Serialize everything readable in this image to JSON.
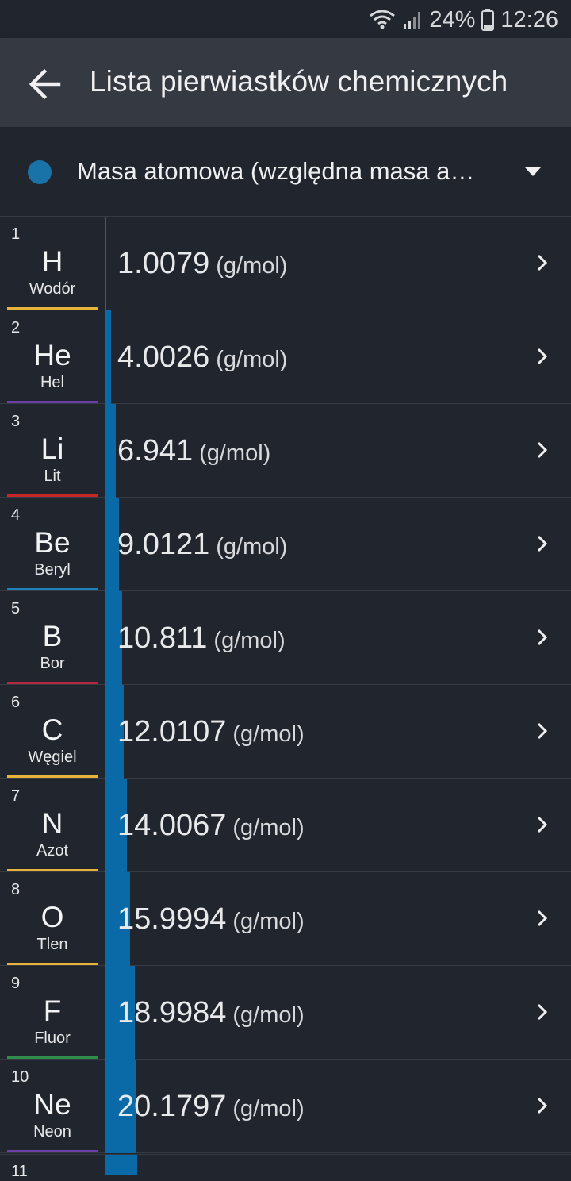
{
  "status": {
    "battery": "24%",
    "time": "12:26"
  },
  "appbar": {
    "title": "Lista pierwiastków chemicznych"
  },
  "selector": {
    "label": "Masa atomowa (względna masa a…",
    "dot_color": "#1a73a8"
  },
  "accent": "#0a6aa8",
  "unit": "(g/mol)",
  "elements": [
    {
      "num": "1",
      "sym": "H",
      "name": "Wodór",
      "value": "1.0079",
      "fraction": 0.01,
      "color": "#e8b33a"
    },
    {
      "num": "2",
      "sym": "He",
      "name": "Hel",
      "value": "4.0026",
      "fraction": 0.04,
      "color": "#6b3fa6"
    },
    {
      "num": "3",
      "sym": "Li",
      "name": "Lit",
      "value": "6.941",
      "fraction": 0.07,
      "color": "#c62828"
    },
    {
      "num": "4",
      "sym": "Be",
      "name": "Beryl",
      "value": "9.0121",
      "fraction": 0.09,
      "color": "#1f7fb7"
    },
    {
      "num": "5",
      "sym": "B",
      "name": "Bor",
      "value": "10.811",
      "fraction": 0.11,
      "color": "#b5283f"
    },
    {
      "num": "6",
      "sym": "C",
      "name": "Węgiel",
      "value": "12.0107",
      "fraction": 0.12,
      "color": "#e8b33a"
    },
    {
      "num": "7",
      "sym": "N",
      "name": "Azot",
      "value": "14.0067",
      "fraction": 0.14,
      "color": "#e8b33a"
    },
    {
      "num": "8",
      "sym": "O",
      "name": "Tlen",
      "value": "15.9994",
      "fraction": 0.16,
      "color": "#e8b33a"
    },
    {
      "num": "9",
      "sym": "F",
      "name": "Fluor",
      "value": "18.9984",
      "fraction": 0.19,
      "color": "#2e8b4a"
    },
    {
      "num": "10",
      "sym": "Ne",
      "name": "Neon",
      "value": "20.1797",
      "fraction": 0.2,
      "color": "#6b3fa6"
    }
  ],
  "partial": {
    "num": "11",
    "fraction": 0.23
  }
}
